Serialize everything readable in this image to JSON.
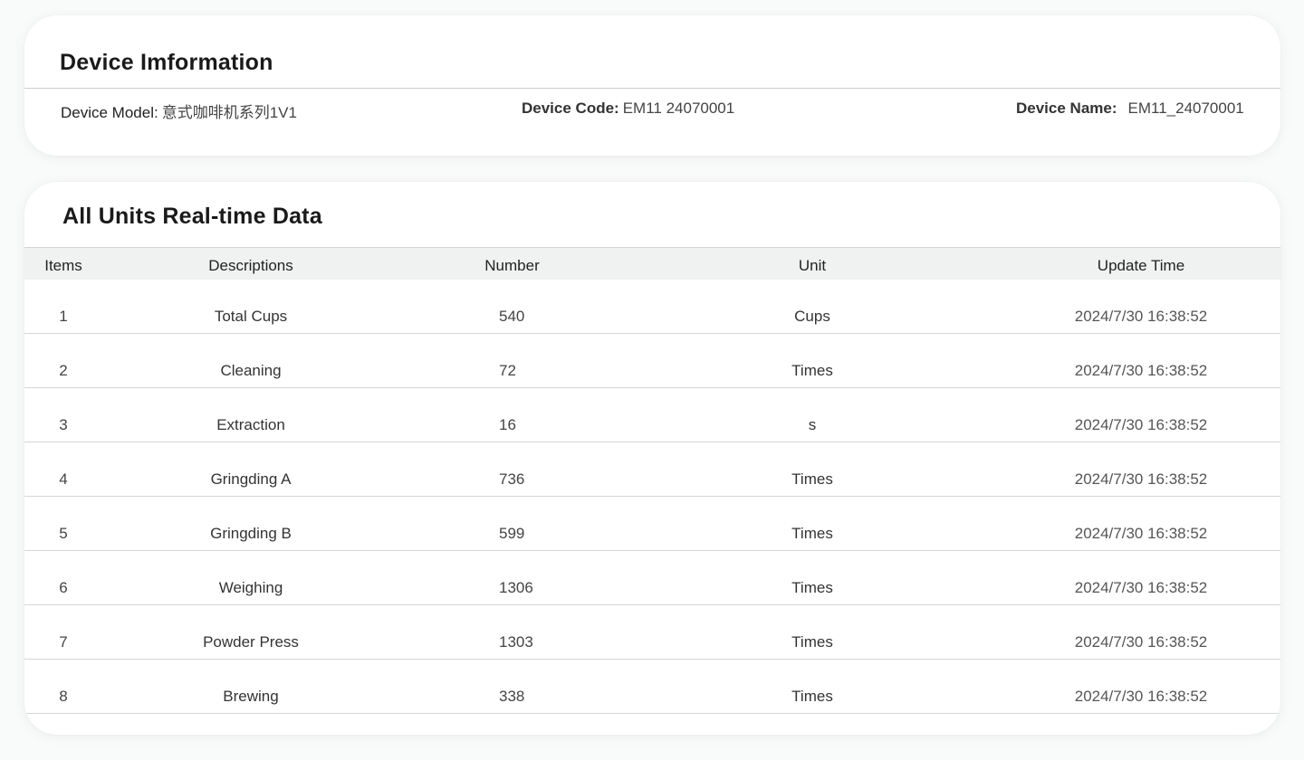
{
  "device_info": {
    "title": "Device Imformation",
    "model_label": "Device Model:",
    "model_value": "意式咖啡机系列1V1",
    "code_label": "Device Code:",
    "code_value": "EM11 24070001",
    "name_label": "Device Name:",
    "name_value": "EM11_24070001"
  },
  "realtime": {
    "title": "All Units Real-time Data",
    "columns": {
      "items": "Items",
      "descriptions": "Descriptions",
      "number": "Number",
      "unit": "Unit",
      "update_time": "Update Time"
    },
    "rows": [
      {
        "item": "1",
        "description": "Total Cups",
        "number": "540",
        "unit": "Cups",
        "time": "2024/7/30 16:38:52"
      },
      {
        "item": "2",
        "description": "Cleaning",
        "number": "72",
        "unit": "Times",
        "time": "2024/7/30 16:38:52"
      },
      {
        "item": "3",
        "description": "Extraction",
        "number": "16",
        "unit": "s",
        "time": "2024/7/30 16:38:52"
      },
      {
        "item": "4",
        "description": "Gringding A",
        "number": "736",
        "unit": "Times",
        "time": "2024/7/30 16:38:52"
      },
      {
        "item": "5",
        "description": "Gringding B",
        "number": "599",
        "unit": "Times",
        "time": "2024/7/30 16:38:52"
      },
      {
        "item": "6",
        "description": "Weighing",
        "number": "1306",
        "unit": "Times",
        "time": "2024/7/30 16:38:52"
      },
      {
        "item": "7",
        "description": "Powder Press",
        "number": "1303",
        "unit": "Times",
        "time": "2024/7/30 16:38:52"
      },
      {
        "item": "8",
        "description": "Brewing",
        "number": "338",
        "unit": "Times",
        "time": "2024/7/30 16:38:52"
      }
    ]
  }
}
